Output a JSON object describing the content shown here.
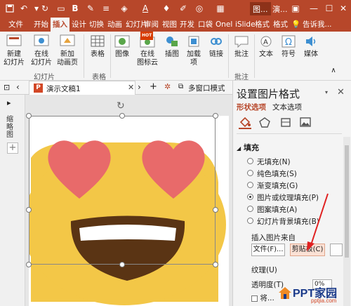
{
  "window": {
    "title_tab_1": "图...",
    "title_tab_2": "演..."
  },
  "ribbon_tabs": [
    "文件",
    "开始",
    "插入",
    "设计",
    "切换",
    "动画",
    "幻灯片",
    "审阅",
    "视图",
    "开发",
    "口袋",
    "Onel",
    "iSlide",
    "格式",
    "格式"
  ],
  "ribbon_tabs_hint": "告诉我...",
  "ribbon_buttons": {
    "new_slide": "新建\n幻灯片",
    "online_slide": "在线\n幻灯片",
    "new_anim_page": "新加\n动画页",
    "table": "表格",
    "image": "图像",
    "online_icons": "在线\n图标云",
    "illustration": "插图",
    "addin": "加载\n项",
    "link": "链接",
    "comment": "批注",
    "text": "文本",
    "symbol": "符号",
    "media": "媒体",
    "hot_badge": "HOT"
  },
  "ribbon_groups": {
    "slides": "幻灯片",
    "tables": "表格",
    "comments": "批注"
  },
  "doc_tab": {
    "icon_letter": "P",
    "name": "演示文稿1",
    "multi_window": "多窗口模式"
  },
  "left_pane": {
    "label": "缩略图"
  },
  "format_pane": {
    "title": "设置图片格式",
    "subtab_shape": "形状选项",
    "subtab_text": "文本选项",
    "section_fill": "填充",
    "fill_options": [
      {
        "label": "无填充(N)",
        "selected": false
      },
      {
        "label": "纯色填充(S)",
        "selected": false
      },
      {
        "label": "渐变填充(G)",
        "selected": false
      },
      {
        "label": "图片或纹理填充(P)",
        "selected": true
      },
      {
        "label": "图案填充(A)",
        "selected": false
      },
      {
        "label": "幻灯片背景填充(B)",
        "selected": false
      }
    ],
    "insert_from": "插入图片来自",
    "file_button": "文件(F)...",
    "clipboard_button": "剪贴板(C)",
    "texture": "纹理(U)",
    "transparency": "透明度(T)",
    "transparency_value": "0%",
    "tile_label": "将..."
  },
  "watermark": {
    "brand": "PPT家园",
    "url": "pptjia.com"
  },
  "colors": {
    "accent": "#b7472a",
    "highlight": "#fbe1d5",
    "emoji_face": "#f3c747",
    "heart": "#e86a6a",
    "mouth": "#5a3414"
  }
}
